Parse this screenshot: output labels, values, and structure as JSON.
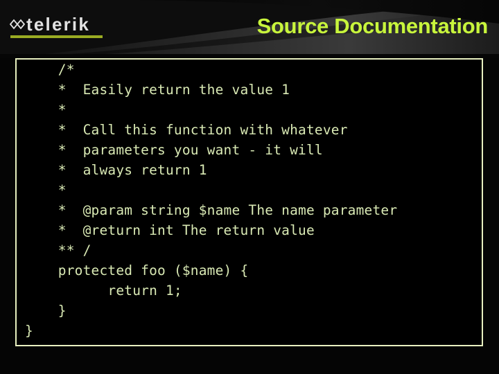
{
  "slide": {
    "title": "Source Documentation",
    "brand": {
      "wordmark": "telerik",
      "mark_icon": "telerik-bowtie-logo-icon",
      "accent_color": "#9aab23"
    },
    "title_color": "#c8f53c",
    "background_color": "#050505"
  },
  "code_block": {
    "border_color": "#e8f0c0",
    "text_color": "#d9e9b4",
    "background_color": "#000000",
    "language": "php",
    "lines": [
      "    /*",
      "    *  Easily return the value 1",
      "    *",
      "    *  Call this function with whatever",
      "    *  parameters you want - it will",
      "    *  always return 1",
      "    *",
      "    *  @param string $name The name parameter",
      "    *  @return int The return value",
      "    ** /",
      "    protected foo ($name) {",
      "          return 1;",
      "    }",
      "}"
    ]
  }
}
